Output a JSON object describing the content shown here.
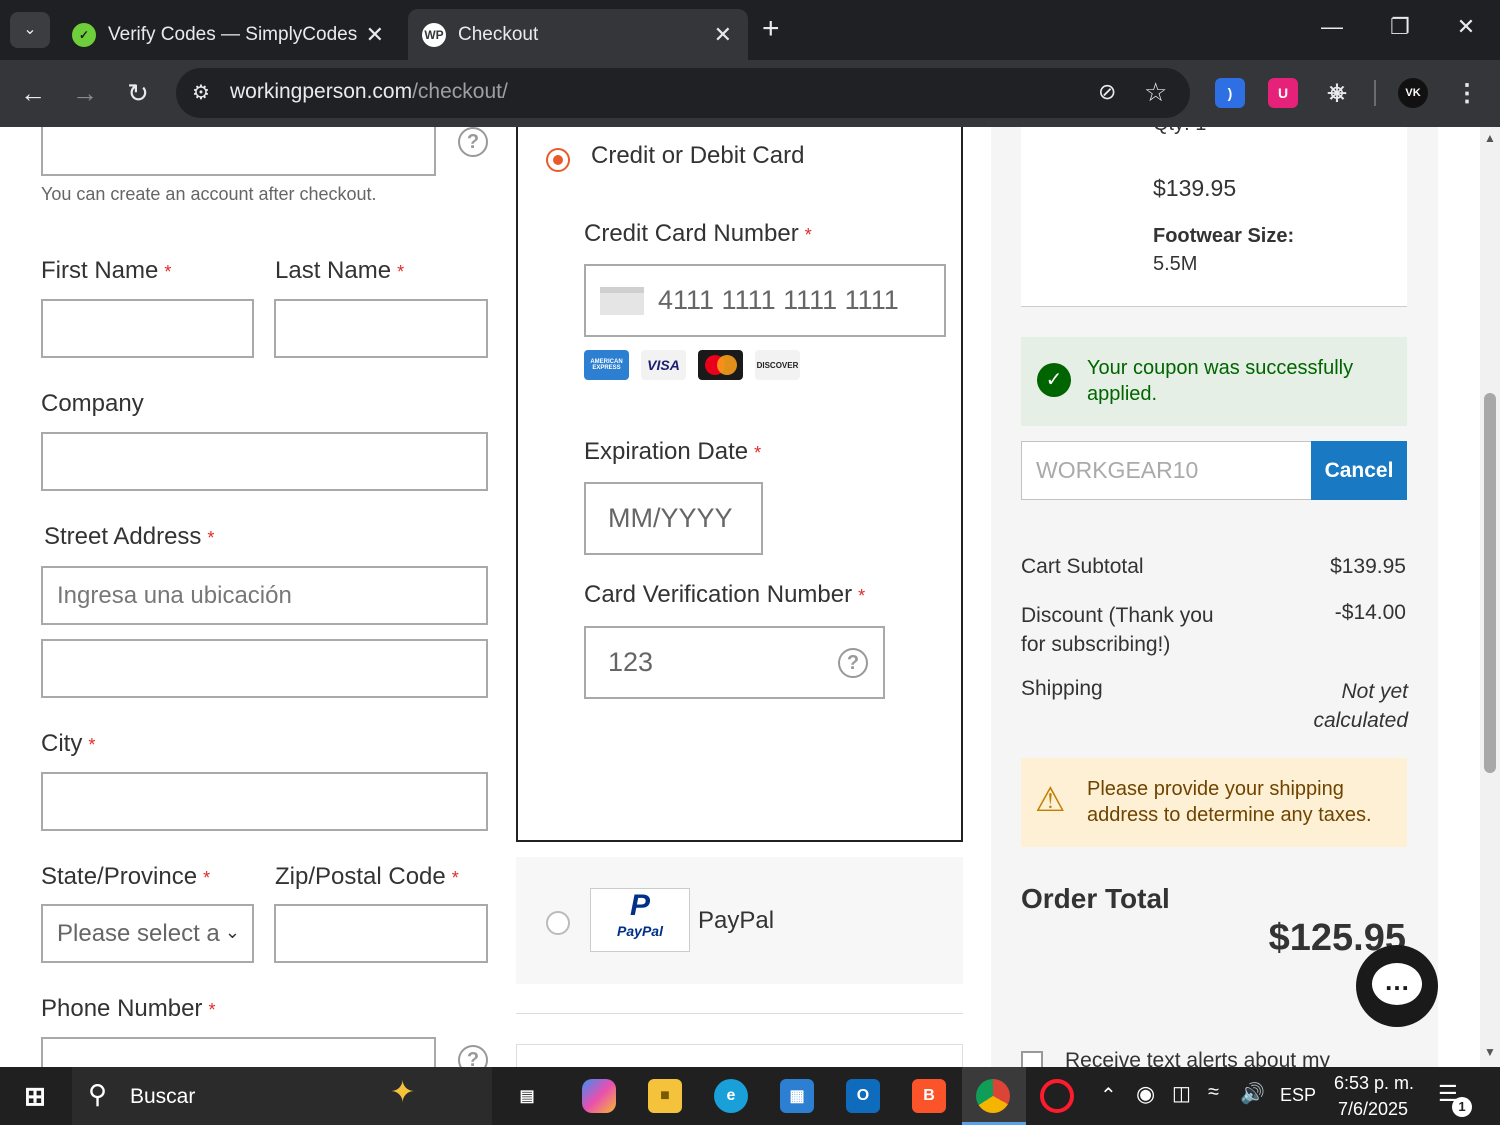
{
  "browser": {
    "tabs": [
      {
        "label": "Verify Codes — SimplyCodes",
        "active": false
      },
      {
        "label": "Checkout",
        "active": true
      }
    ],
    "url_domain": "workingperson.com",
    "url_path": "/checkout/"
  },
  "form": {
    "account_note": "You can create an account after checkout.",
    "first_name_label": "First Name",
    "last_name_label": "Last Name",
    "company_label": "Company",
    "street_label": "Street Address",
    "street_placeholder": "Ingresa una ubicación",
    "city_label": "City",
    "state_label": "State/Province",
    "state_value": "Please select a",
    "zip_label": "Zip/Postal Code",
    "phone_label": "Phone Number",
    "required_mark": "*"
  },
  "payment": {
    "card_option_label": "Credit or Debit Card",
    "card_number_label": "Credit Card Number",
    "card_number_placeholder": "4111 1111 1111 1111",
    "card_logos": [
      "AMERICAN EXPRESS",
      "VISA",
      "mastercard",
      "DISCOVER"
    ],
    "expiration_label": "Expiration Date",
    "expiration_placeholder": "MM/YYYY",
    "cvv_label": "Card Verification Number",
    "cvv_placeholder": "123",
    "paypal_label": "PayPal",
    "paypal_logo_top": "P",
    "paypal_logo_text": "PayPal"
  },
  "summary": {
    "qty_partial": "Qty: 1",
    "item_price": "$139.95",
    "size_label": "Footwear Size:",
    "size_value": "5.5M",
    "coupon_success": "Your coupon was successfully applied.",
    "coupon_code": "WORKGEAR10",
    "cancel_button": "Cancel",
    "subtotal_label": "Cart Subtotal",
    "subtotal_value": "$139.95",
    "discount_label": "Discount (Thank you for subscribing!)",
    "discount_value": "-$14.00",
    "shipping_label": "Shipping",
    "shipping_value": "Not yet calculated",
    "tax_warning": "Please provide your shipping address to determine any taxes.",
    "order_total_label": "Order Total",
    "order_total_value": "$125.95",
    "sms_label": "Receive text alerts about my"
  },
  "taskbar": {
    "search_label": "Buscar",
    "language": "ESP",
    "time": "6:53 p. m.",
    "date": "7/6/2025",
    "notification_count": "1"
  },
  "colors": {
    "accent_orange": "#e85a2c",
    "cancel_blue": "#1979c3",
    "success_bg": "#e5efe5",
    "success_text": "#006400",
    "warning_bg": "#fdf0d5",
    "warning_text": "#6f4400"
  }
}
